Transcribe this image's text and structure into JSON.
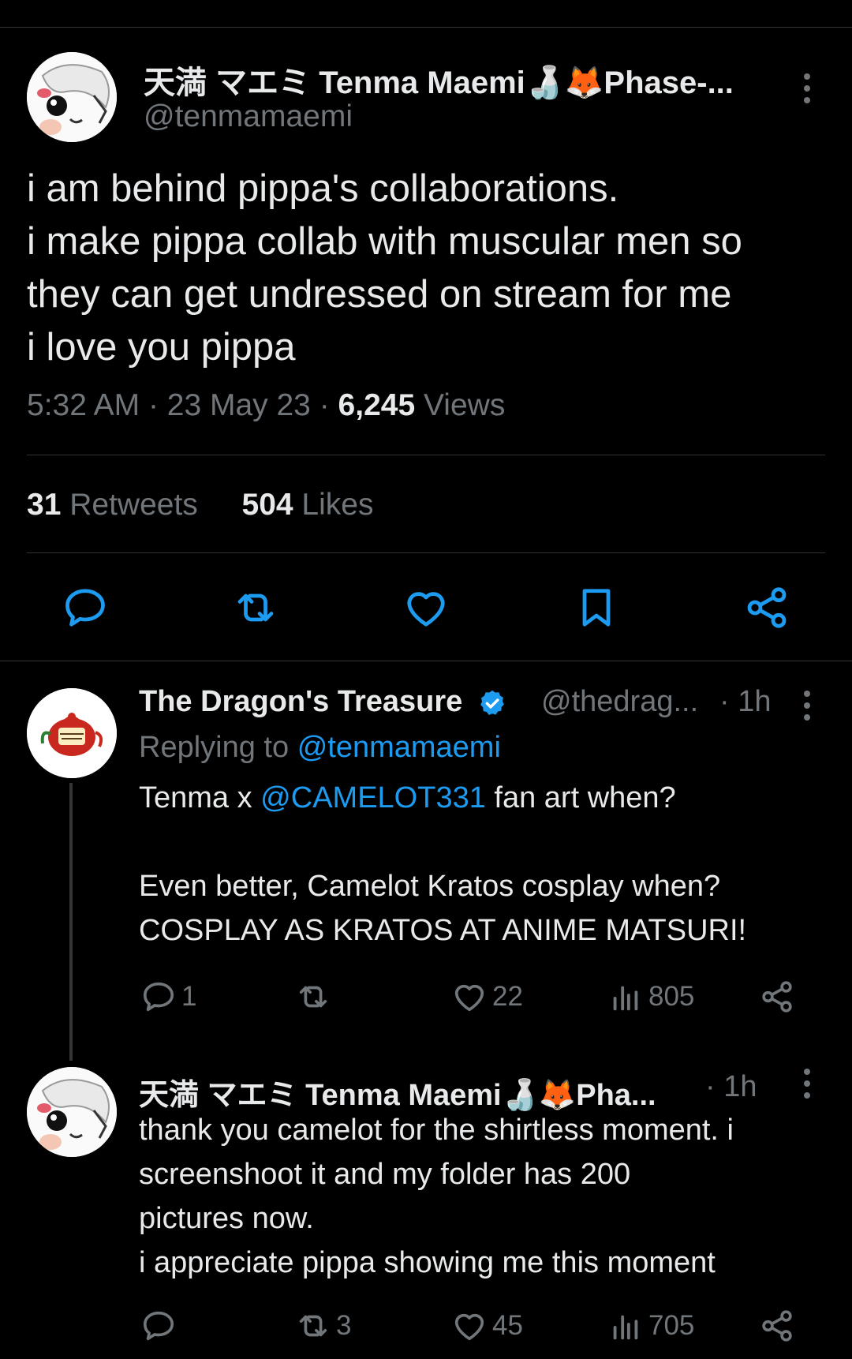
{
  "main_tweet": {
    "author_name": "天満 マエミ Tenma Maemi🍶🦊Phase-...",
    "handle": "@tenmamaemi",
    "text_lines": [
      "i am behind pippa's collaborations.",
      "i make pippa collab with muscular men so",
      "they can get undressed on stream for me",
      "i love you pippa"
    ],
    "time": "5:32 AM",
    "date": "23 May 23",
    "views_count": "6,245",
    "views_label": "Views",
    "retweets_count": "31",
    "retweets_label": "Retweets",
    "likes_count": "504",
    "likes_label": "Likes",
    "actions": [
      "reply-icon",
      "retweet-icon",
      "like-icon",
      "bookmark-icon",
      "share-icon"
    ]
  },
  "replies": [
    {
      "author_name": "The Dragon's Treasure",
      "verified": true,
      "handle": "@thedrag...",
      "time": "· 1h",
      "replying_label": "Replying to",
      "replying_handle": "@tenmamaemi",
      "text_pre": "Tenma x ",
      "mention": "@CAMELOT331",
      "text_post": " fan art when?",
      "text_lines": [
        "",
        "Even better, Camelot Kratos cosplay when?",
        "COSPLAY AS KRATOS AT ANIME MATSURI!"
      ],
      "reply_count": "1",
      "retweet_count": "",
      "like_count": "22",
      "view_count": "805"
    },
    {
      "author_name": "天満 マエミ Tenma Maemi🍶🦊Pha...",
      "handle": "",
      "time": "· 1h",
      "text_lines": [
        "thank you camelot for the shirtless moment. i",
        "screenshoot it and my folder has 200",
        "pictures now.",
        "i appreciate pippa showing me this moment"
      ],
      "reply_count": "",
      "retweet_count": "3",
      "like_count": "45",
      "view_count": "705"
    }
  ],
  "colors": {
    "background": "#000000",
    "text": "#e7e9ea",
    "secondary": "#71767b",
    "link": "#1d9bf0",
    "divider": "#2f3336"
  }
}
